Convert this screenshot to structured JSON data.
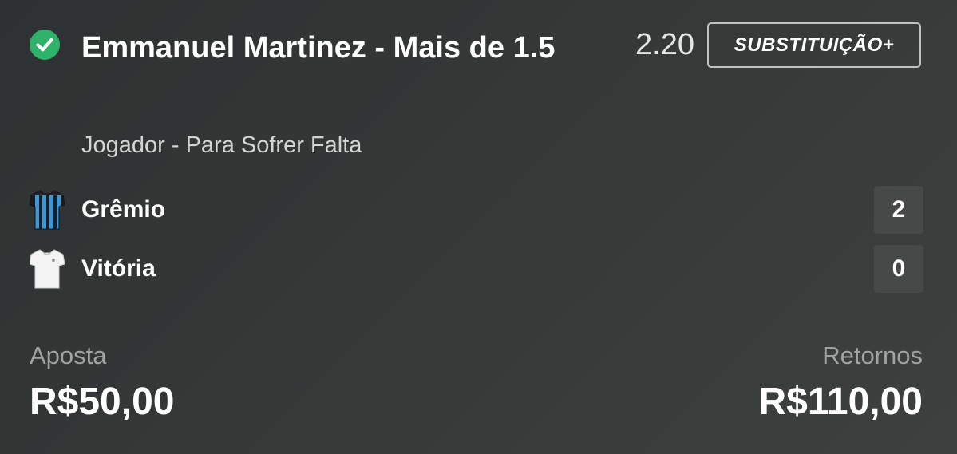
{
  "bet": {
    "status_icon": "check-circle-icon",
    "selection": "Emmanuel Martinez - Mais de 1.5",
    "odds": "2.20",
    "substitution_label": "SUBSTITUIÇÃO+",
    "market": "Jogador - Para Sofrer Falta"
  },
  "match": {
    "home": {
      "name": "Grêmio",
      "score": "2",
      "shirt_icon": "striped-shirt-icon"
    },
    "away": {
      "name": "Vitória",
      "score": "0",
      "shirt_icon": "white-shirt-icon"
    }
  },
  "summary": {
    "stake_label": "Aposta",
    "stake_value": "R$50,00",
    "returns_label": "Retornos",
    "returns_value": "R$110,00"
  },
  "colors": {
    "success_green": "#2fb36b",
    "background": "#343837",
    "score_box": "#464948"
  }
}
